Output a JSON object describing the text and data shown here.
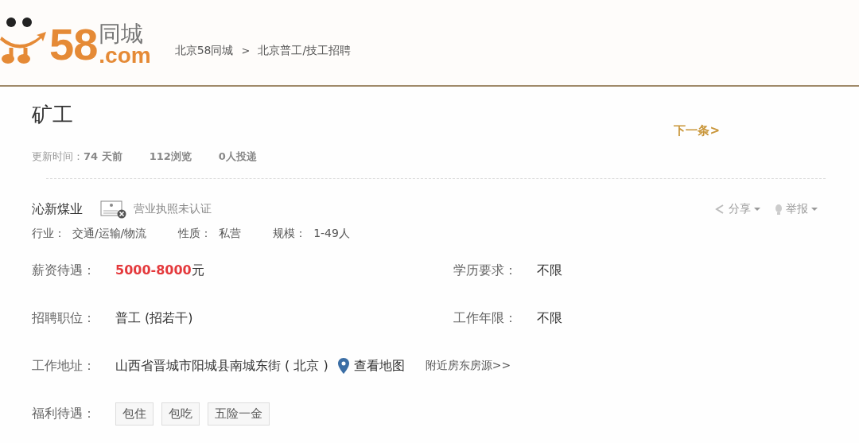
{
  "header": {
    "logo": {
      "number": "58",
      "cn": "同城",
      "domain": ".com"
    },
    "breadcrumb": [
      {
        "label": "北京58同城"
      },
      {
        "label": "北京普工/技工招聘"
      }
    ],
    "separator": ">"
  },
  "job": {
    "title": "矿工",
    "next_link": "下一条>",
    "meta": [
      {
        "label": "更新时间：",
        "value": "74 天前"
      },
      {
        "value": "112浏览"
      },
      {
        "value": "0人投递"
      }
    ]
  },
  "company": {
    "name": "沁新煤业",
    "license_status": "营业执照未认证",
    "verified": false,
    "actions": [
      {
        "kind": "share",
        "label": "分享"
      },
      {
        "kind": "report",
        "label": "举报"
      }
    ],
    "facts": [
      {
        "label": "行业：",
        "value": "交通/运输/物流"
      },
      {
        "label": "性质：",
        "value": "私营"
      },
      {
        "label": "规模：",
        "value": "1-49人"
      }
    ]
  },
  "details": [
    {
      "kind": "salary",
      "label": "薪资待遇：",
      "amount": "5000-8000",
      "unit": "元",
      "side_label": "学历要求：",
      "side_value": "不限"
    },
    {
      "kind": "plain",
      "label": "招聘职位：",
      "value": "普工 (招若干)",
      "side_label": "工作年限：",
      "side_value": "不限"
    },
    {
      "kind": "address",
      "label": "工作地址：",
      "value": "山西省晋城市阳城县南城东街 ( 北京 )",
      "map_link": "查看地图",
      "nearby_link": "附近房东房源>>"
    },
    {
      "kind": "tags",
      "label": "福利待遇：",
      "tags": [
        "包住",
        "包吃",
        "五险一金"
      ]
    }
  ]
}
